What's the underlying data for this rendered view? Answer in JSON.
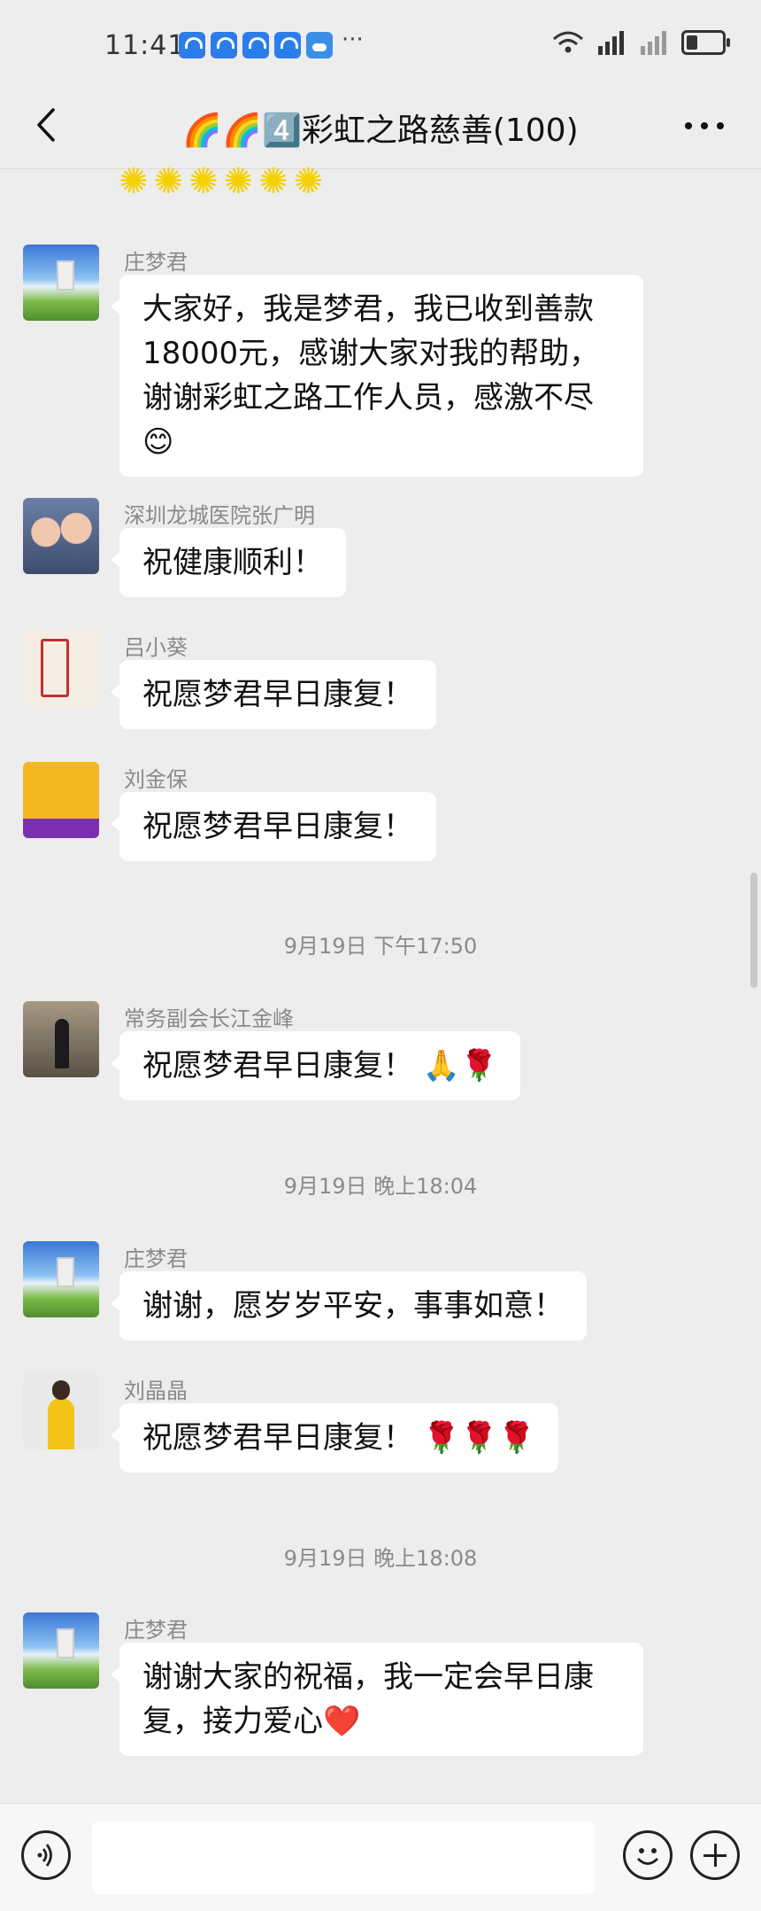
{
  "status": {
    "time": "11:41",
    "more": "···"
  },
  "nav": {
    "title": "🌈🌈4️⃣彩虹之路慈善(100)"
  },
  "chat": {
    "top_stickers": "✺✺✺✺✺✺",
    "messages": [
      {
        "sender": "庄梦君",
        "text": "大家好，我是梦君，我已收到善款18000元，感谢大家对我的帮助，谢谢彩虹之路工作人员，感激不尽😊"
      },
      {
        "sender": "深圳龙城医院张广明",
        "text": "祝健康顺利！"
      },
      {
        "sender": "吕小葵",
        "text": "祝愿梦君早日康复！"
      },
      {
        "sender": "刘金保",
        "text": "祝愿梦君早日康复！"
      },
      {
        "sender": "常务副会长江金峰",
        "text": "祝愿梦君早日康复！ 🙏🌹"
      },
      {
        "sender": "庄梦君",
        "text": "谢谢，愿岁岁平安，事事如意！"
      },
      {
        "sender": "刘晶晶",
        "text": "祝愿梦君早日康复！ 🌹🌹🌹"
      },
      {
        "sender": "庄梦君",
        "text": "谢谢大家的祝福，我一定会早日康复，接力爱心❤️"
      }
    ],
    "timestamps": [
      "9月19日 下午17:50",
      "9月19日 晚上18:04",
      "9月19日 晚上18:08"
    ]
  },
  "input": {
    "placeholder": ""
  }
}
